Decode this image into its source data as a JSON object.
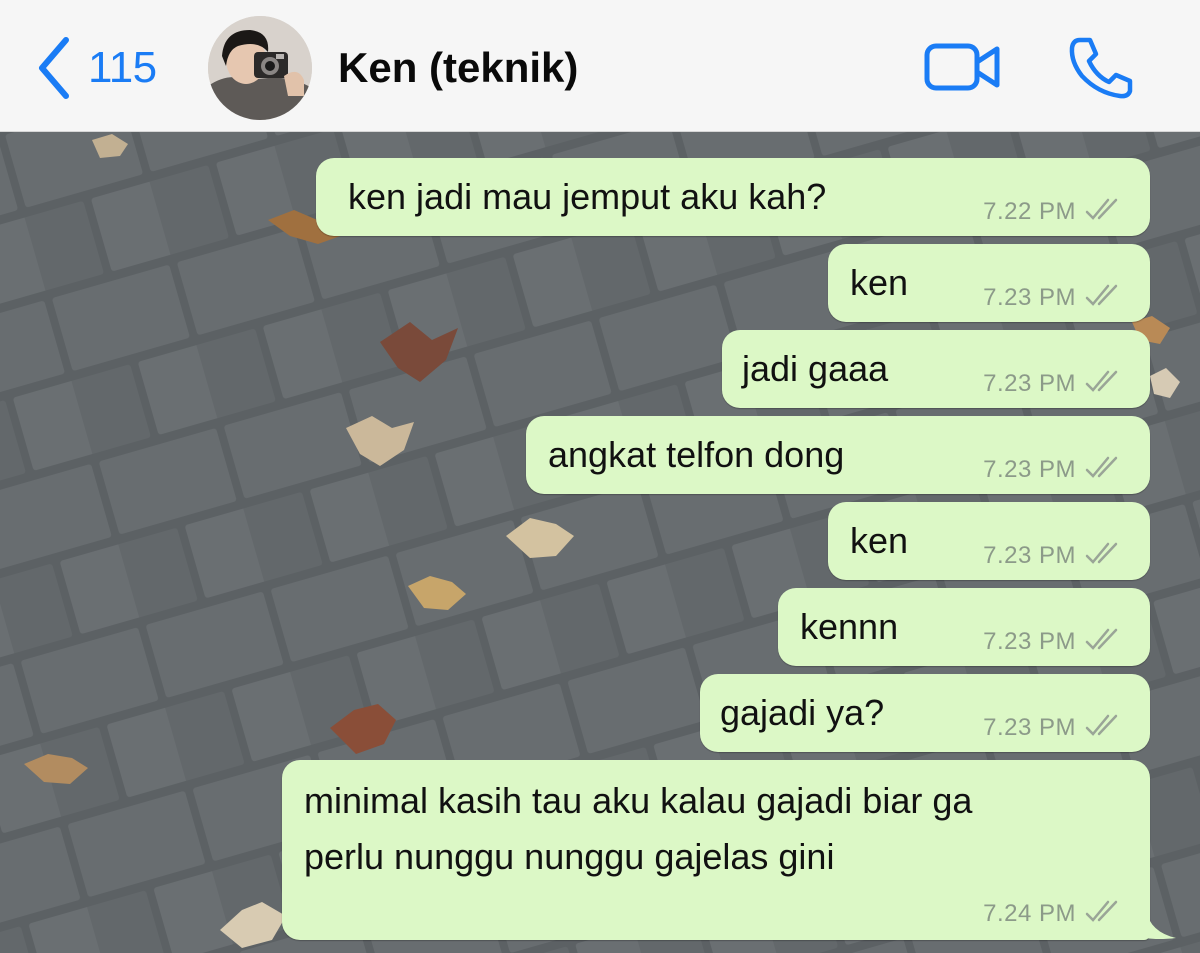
{
  "header": {
    "back_count": "115",
    "contact_name": "Ken (teknik)"
  },
  "messages": [
    {
      "text": "ken jadi mau jemput aku kah?",
      "time": "7.22 PM",
      "status": "sent"
    },
    {
      "text": "ken",
      "time": "7.23 PM",
      "status": "sent"
    },
    {
      "text": "jadi gaaa",
      "time": "7.23 PM",
      "status": "sent"
    },
    {
      "text": "angkat telfon dong",
      "time": "7.23 PM",
      "status": "sent"
    },
    {
      "text": "ken",
      "time": "7.23 PM",
      "status": "sent"
    },
    {
      "text": "kennn",
      "time": "7.23 PM",
      "status": "sent"
    },
    {
      "text": "gajadi ya?",
      "time": "7.23 PM",
      "status": "sent"
    },
    {
      "text": "minimal kasih tau aku kalau gajadi biar ga",
      "text_line2": "perlu nunggu nunggu gajelas gini",
      "time": "7.24 PM",
      "status": "sent"
    }
  ],
  "icons": {
    "back": "chevron-left-icon",
    "video": "video-camera-icon",
    "phone": "phone-icon",
    "ticks": "double-check-icon"
  },
  "colors": {
    "accent": "#1a7cf5",
    "bubble_outgoing": "#dcf8c6",
    "header_bg": "#f6f6f6"
  }
}
